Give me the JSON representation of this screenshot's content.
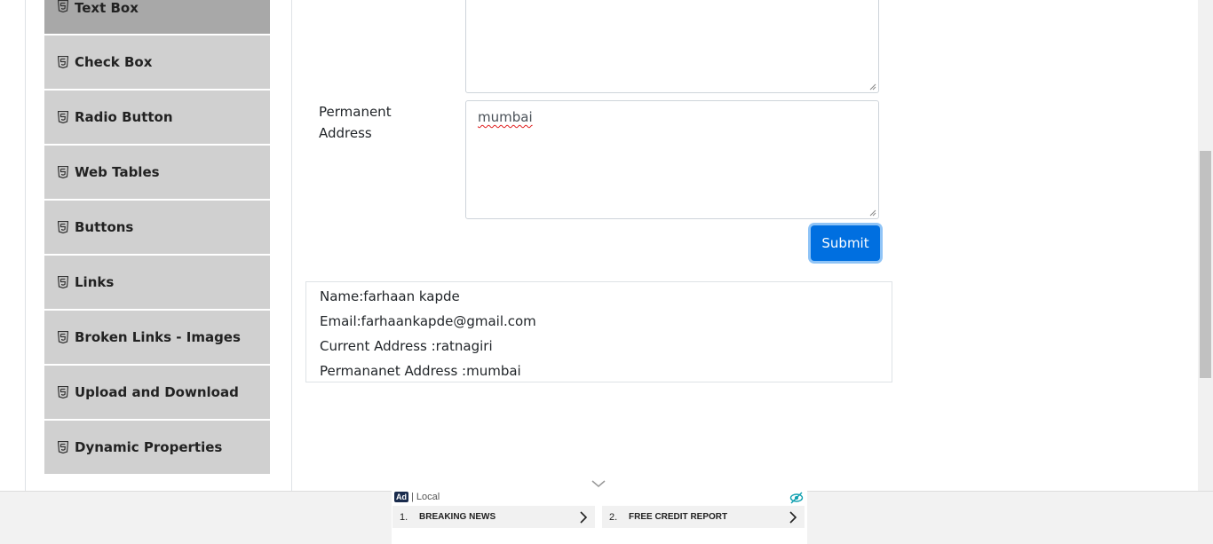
{
  "sidebar": {
    "items": [
      {
        "label": "Text Box",
        "icon": "html5-icon"
      },
      {
        "label": "Check Box",
        "icon": "html5-icon"
      },
      {
        "label": "Radio Button",
        "icon": "html5-icon"
      },
      {
        "label": "Web Tables",
        "icon": "html5-icon"
      },
      {
        "label": "Buttons",
        "icon": "html5-icon"
      },
      {
        "label": "Links",
        "icon": "html5-icon"
      },
      {
        "label": "Broken Links - Images",
        "icon": "html5-icon"
      },
      {
        "label": "Upload and Download",
        "icon": "html5-icon"
      },
      {
        "label": "Dynamic Properties",
        "icon": "html5-icon"
      }
    ]
  },
  "form": {
    "permanent_address_label_line1": "Permanent",
    "permanent_address_label_line2": "Address",
    "current_address_value": "",
    "permanent_address_value": "mumbai",
    "submit_label": "Submit"
  },
  "output": {
    "name": "Name:farhaan kapde",
    "email": "Email:farhaankapde@gmail.com",
    "current_address": "Current Address :ratnagiri",
    "permanent_address": "Permananet Address :mumbai"
  },
  "ad": {
    "badge": "Ad",
    "source": "| Local",
    "links": [
      {
        "num": "1.",
        "text": "BREAKING NEWS"
      },
      {
        "num": "2.",
        "text": "FREE CREDIT REPORT"
      }
    ]
  },
  "colors": {
    "submit_bg": "#006fe0",
    "menu_bg": "#d0d0d0",
    "menu_active_bg": "#a8a8a8"
  }
}
